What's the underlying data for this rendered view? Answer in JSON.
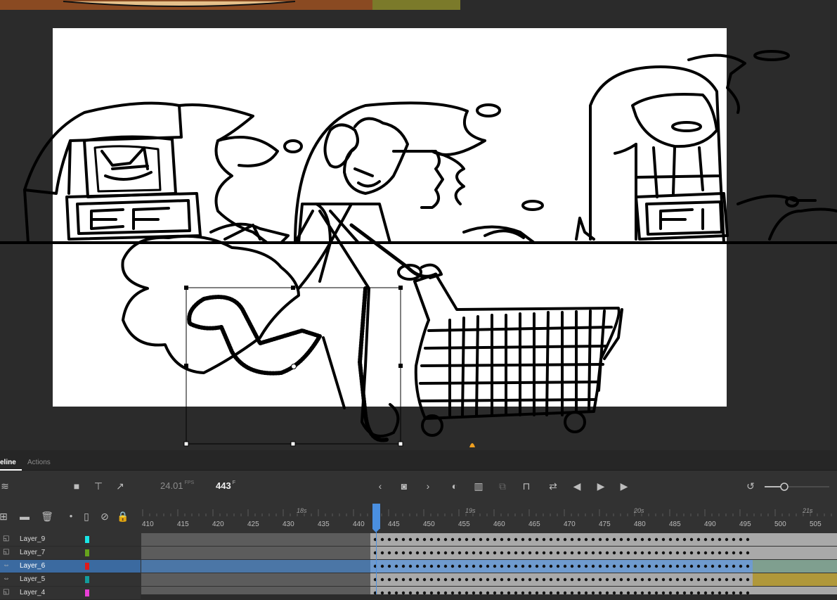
{
  "stage": {
    "pasteboard_colors": [
      "#8a4a22",
      "#7b7a2a"
    ]
  },
  "panel": {
    "tabs": [
      {
        "label": "eline",
        "active": true
      },
      {
        "label": "Actions",
        "active": false
      }
    ],
    "toolbar": {
      "fps": "24.01",
      "fps_unit": "FPS",
      "frame": "443",
      "frame_unit": "F"
    },
    "ruler": {
      "seconds": [
        "18s",
        "19s",
        "20s",
        "21s"
      ],
      "frames": [
        "410",
        "415",
        "420",
        "425",
        "430",
        "435",
        "440",
        "445",
        "450",
        "455",
        "460",
        "465",
        "470",
        "475",
        "480",
        "485",
        "490",
        "495",
        "500",
        "505"
      ],
      "current_frame": 443
    },
    "layers": [
      {
        "name": "Layer_9",
        "color": "#19e5e5",
        "selected": false,
        "icon": "layer-icon"
      },
      {
        "name": "Layer_7",
        "color": "#66a31c",
        "selected": false,
        "icon": "layer-icon"
      },
      {
        "name": "Layer_6",
        "color": "#e01a1a",
        "selected": true,
        "icon": "camera-parent-icon"
      },
      {
        "name": "Layer_5",
        "color": "#129c9c",
        "selected": false,
        "icon": "camera-parent-icon"
      },
      {
        "name": "Layer_4",
        "color": "#e83fd6",
        "selected": false,
        "icon": "layer-icon"
      }
    ]
  }
}
